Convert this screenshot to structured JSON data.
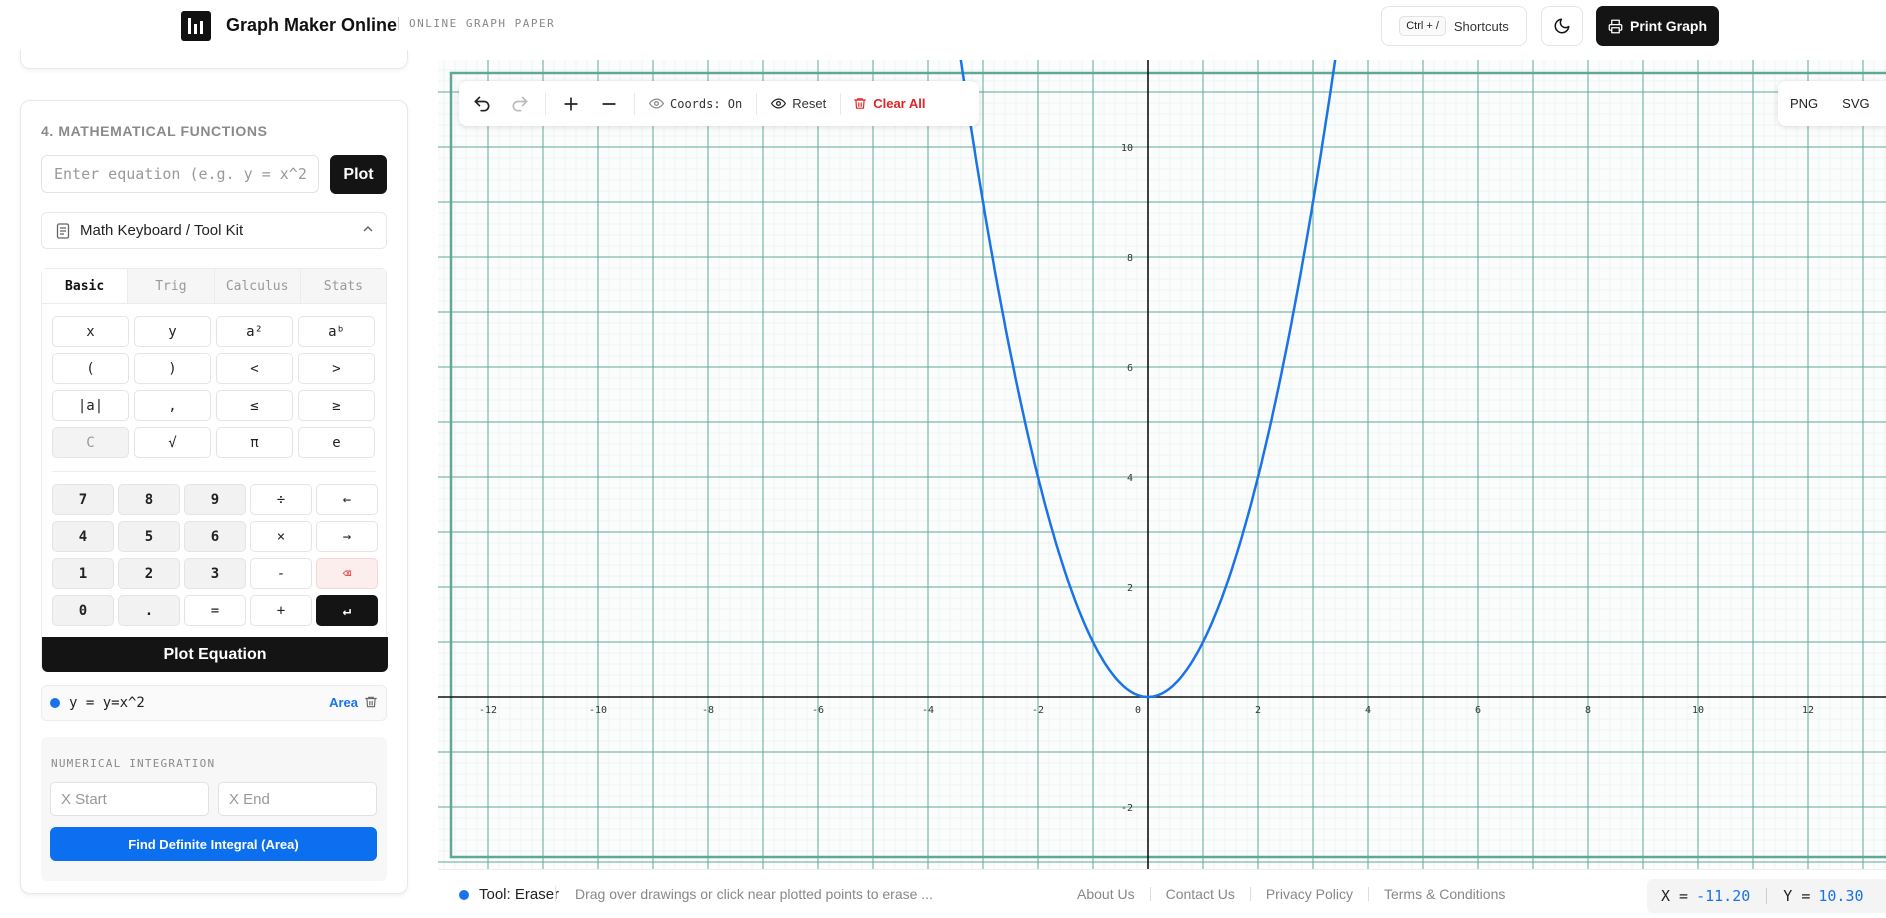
{
  "header": {
    "title": "Graph Maker Online",
    "subtitle": "ONLINE GRAPH PAPER",
    "shortcut_key": "Ctrl + /",
    "shortcut_label": "Shortcuts",
    "print_label": "Print Graph"
  },
  "sidebar": {
    "section_title": "4. MATHEMATICAL FUNCTIONS",
    "equation_input": {
      "placeholder": "Enter equation (e.g. y = x^2)",
      "value": ""
    },
    "plot_label": "Plot",
    "keyboard_toggle": "Math Keyboard / Tool Kit",
    "tabs": [
      {
        "label": "Basic",
        "active": true
      },
      {
        "label": "Trig",
        "active": false
      },
      {
        "label": "Calculus",
        "active": false
      },
      {
        "label": "Stats",
        "active": false
      }
    ],
    "symbol_keys": [
      "x",
      "y",
      "a²",
      "aᵇ",
      "(",
      ")",
      "<",
      ">",
      "|a|",
      ",",
      "≤",
      "≥",
      "C",
      "√",
      "π",
      "e"
    ],
    "numpad_keys": [
      "7",
      "8",
      "9",
      "÷",
      "←",
      "4",
      "5",
      "6",
      "×",
      "→",
      "1",
      "2",
      "3",
      "-",
      "⌫",
      "0",
      ".",
      "=",
      "+",
      "↵"
    ],
    "plot_equation_label": "Plot Equation",
    "equations": [
      {
        "text": "y = y=x^2",
        "color": "#1a73e8",
        "area_label": "Area"
      }
    ],
    "integration": {
      "title": "NUMERICAL INTEGRATION",
      "x_start_placeholder": "X Start",
      "x_end_placeholder": "X End",
      "find_label": "Find Definite Integral (Area)"
    }
  },
  "toolbar": {
    "coords_label": "Coords: On",
    "reset_label": "Reset",
    "clear_label": "Clear All",
    "png_label": "PNG",
    "svg_label": "SVG"
  },
  "graph": {
    "x_ticks": [
      "-12",
      "-10",
      "-8",
      "-6",
      "-4",
      "-2",
      "0",
      "2",
      "4",
      "6",
      "8",
      "10",
      "12"
    ],
    "y_ticks": [
      "10",
      "8",
      "6",
      "4",
      "2",
      "-2"
    ],
    "function": "y = x^2",
    "curve_color": "#1a73e8",
    "grid_color": "#5fa896",
    "axis_color": "#111111"
  },
  "status": {
    "tool": "Tool: Eraser",
    "hint": "Drag over drawings or click near plotted points to erase ...",
    "links": [
      "About Us",
      "Contact Us",
      "Privacy Policy",
      "Terms & Conditions"
    ],
    "x_label": "X =",
    "x_value": "-11.20",
    "y_label": "Y =",
    "y_value": "10.30"
  }
}
